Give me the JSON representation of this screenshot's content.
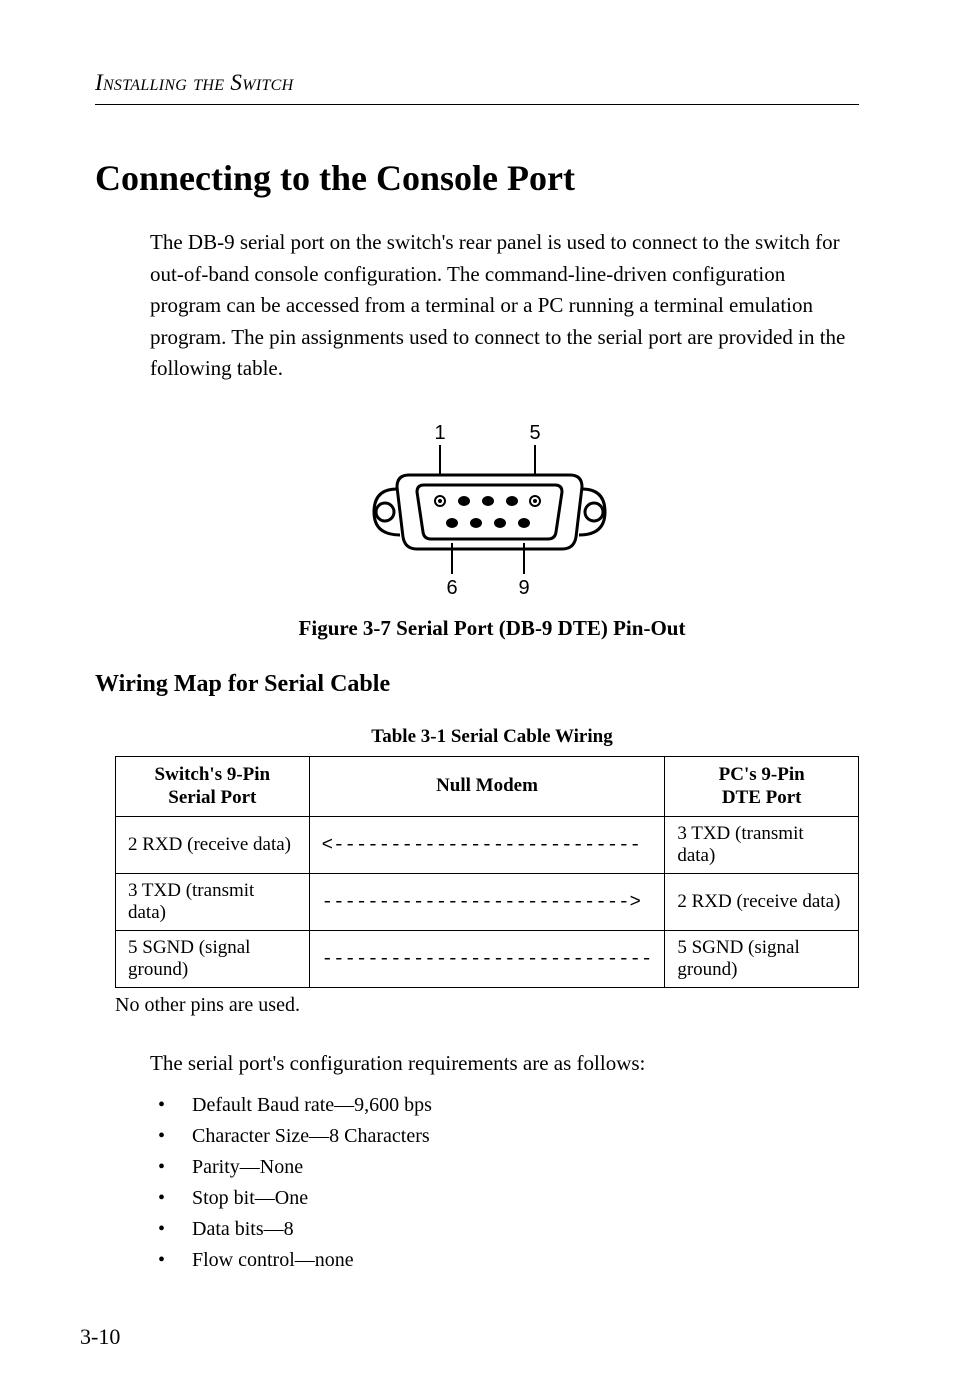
{
  "running_header": "Installing the Switch",
  "heading": "Connecting to the Console Port",
  "intro": "The DB-9 serial port on the switch's rear panel is used to connect to the switch for out-of-band console configuration. The command-line-driven configuration program can be accessed from a terminal or a PC running a terminal emulation program. The pin assignments used to connect to the serial port are provided in the following table.",
  "figure": {
    "pin1": "1",
    "pin5": "5",
    "pin6": "6",
    "pin9": "9",
    "caption": "Figure 3-7  Serial Port (DB-9 DTE) Pin-Out"
  },
  "subheading": "Wiring Map for Serial Cable",
  "table": {
    "caption": "Table 3-1  Serial Cable Wiring",
    "headers": {
      "col1a": "Switch's 9-Pin",
      "col1b": "Serial Port",
      "col2": "Null Modem",
      "col3a": "PC's 9-Pin",
      "col3b": "DTE Port"
    },
    "rows": [
      {
        "c1": "2 RXD (receive data)",
        "c2": "<---------------------------",
        "c3": "3 TXD (transmit data)"
      },
      {
        "c1": "3 TXD (transmit data)",
        "c2": "--------------------------->",
        "c3": "2 RXD (receive data)"
      },
      {
        "c1": "5 SGND (signal ground)",
        "c2": "-----------------------------",
        "c3": "5 SGND (signal ground)"
      }
    ],
    "note": "No other pins are used."
  },
  "config": {
    "intro": "The serial port's configuration requirements are as follows:",
    "items": [
      "Default Baud rate—9,600 bps",
      "Character Size—8 Characters",
      "Parity—None",
      "Stop bit—One",
      "Data bits—8",
      "Flow control—none"
    ]
  },
  "page_number": "3-10"
}
